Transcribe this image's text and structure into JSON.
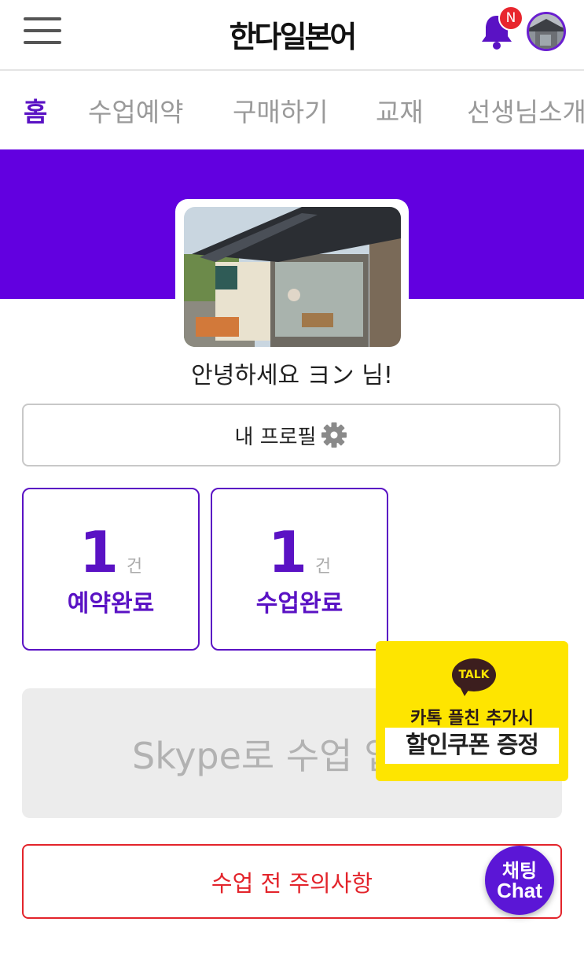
{
  "header": {
    "logo_text": "한다일본어",
    "notification_badge": "N",
    "menu_icon": "hamburger-menu-icon",
    "bell_icon": "bell-icon",
    "accent_color": "#5a12c4"
  },
  "nav": {
    "tabs": [
      {
        "label": "홈",
        "active": true
      },
      {
        "label": "수업예약",
        "active": false
      },
      {
        "label": "구매하기",
        "active": false
      },
      {
        "label": "교재",
        "active": false
      },
      {
        "label": "선생님소개",
        "active": false
      }
    ]
  },
  "banner": {
    "color": "#6200e0"
  },
  "profile": {
    "greeting": "안녕하세요 ヨン 님!",
    "profile_button_label": "내 프로필",
    "profile_button_icon": "gear-icon"
  },
  "stats": [
    {
      "count": "1",
      "unit": "건",
      "label": "예약완료"
    },
    {
      "count": "1",
      "unit": "건",
      "label": "수업완료"
    }
  ],
  "skype": {
    "label": "Skype로 수업 입"
  },
  "notice": {
    "label": "수업 전 주의사항",
    "color": "#e3242b"
  },
  "kakao_promo": {
    "badge": "TALK",
    "line1": "카톡 플친 추가시",
    "line2": "할인쿠폰 증정"
  },
  "chat_button": {
    "line1": "채팅",
    "line2": "Chat"
  }
}
